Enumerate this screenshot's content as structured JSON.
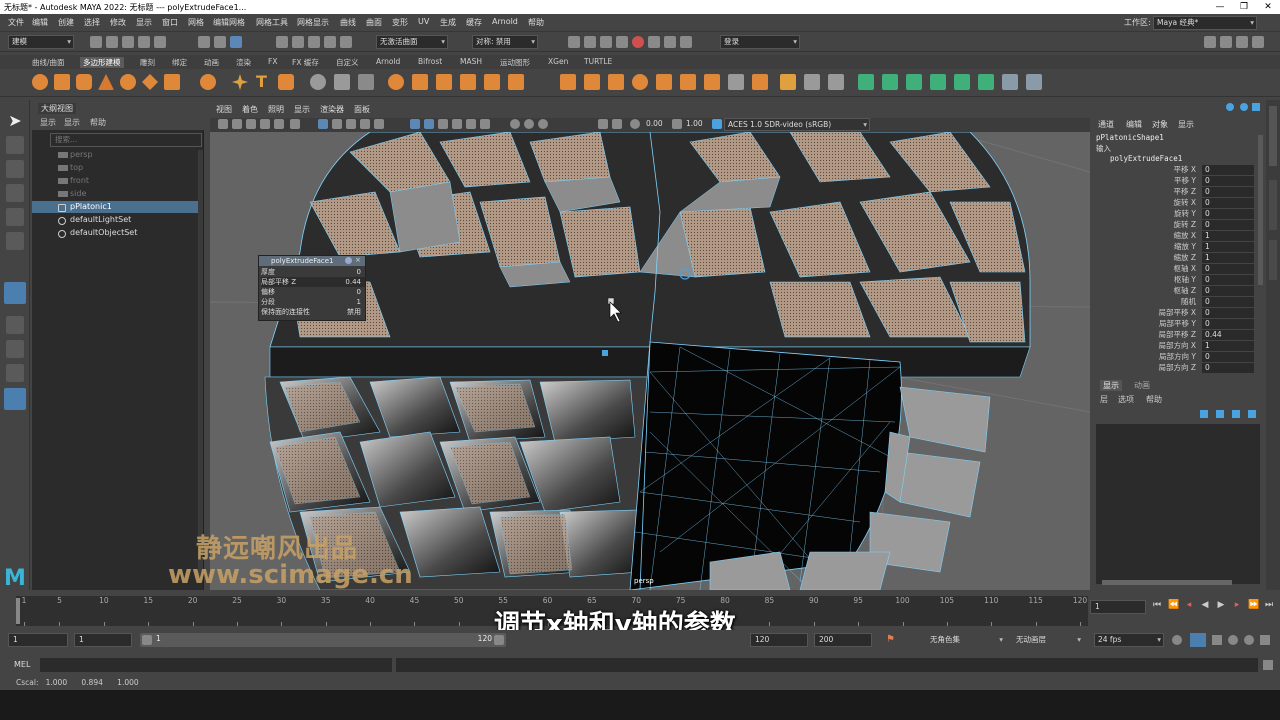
{
  "titlebar": {
    "text": "无标题* - Autodesk MAYA 2022: 无标题   ---   polyExtrudeFace1...",
    "minimize": "—",
    "restore": "❐",
    "close": "✕"
  },
  "menubar": {
    "items": [
      "文件",
      "编辑",
      "创建",
      "选择",
      "修改",
      "显示",
      "窗口",
      "网格",
      "编辑网格",
      "网格工具",
      "网格显示",
      "曲线",
      "曲面",
      "变形",
      "UV",
      "生成",
      "缓存",
      "Arnold",
      "帮助"
    ],
    "workspace_label": "工作区:",
    "workspace_value": "Maya 经典*"
  },
  "statusline": {
    "mode": "建模",
    "live_surface": "无激活曲面",
    "symmetry": "对称: 禁用",
    "login": "登录"
  },
  "shelf": {
    "tabs": [
      "曲线/曲面",
      "多边形建模",
      "雕刻",
      "绑定",
      "动画",
      "渲染",
      "FX",
      "FX 缓存",
      "自定义",
      "Arnold",
      "Bifrost",
      "MASH",
      "运动图形",
      "XGen",
      "TURTLE"
    ],
    "active_tab": "多边形建模"
  },
  "outliner": {
    "title": "大纲视图",
    "menu": [
      "显示",
      "显示",
      "帮助"
    ],
    "search_placeholder": "搜索...",
    "items": [
      "persp",
      "top",
      "front",
      "side",
      "pPlatonic1",
      "defaultLightSet",
      "defaultObjectSet"
    ]
  },
  "viewport": {
    "menu": [
      "视图",
      "着色",
      "照明",
      "显示",
      "渲染器",
      "面板"
    ],
    "exposure": "0.00",
    "gamma": "1.00",
    "colorspace": "ACES 1.0 SDR-video (sRGB)",
    "camera_label": "persp"
  },
  "extrude_hud": {
    "title": "polyExtrudeFace1",
    "rows": [
      {
        "label": "厚度",
        "value": "0"
      },
      {
        "label": "局部平移 Z",
        "value": "0.44"
      },
      {
        "label": "偏移",
        "value": "0"
      },
      {
        "label": "分段",
        "value": "1"
      },
      {
        "label": "保持面的连接性",
        "value": "禁用"
      }
    ]
  },
  "channelbox": {
    "menu": [
      "通道",
      "编辑",
      "对象",
      "显示"
    ],
    "shape_name": "pPlatonicShape1",
    "inputs_label": "输入",
    "node_name": "polyExtrudeFace1",
    "channels": [
      {
        "name": "平移 X",
        "value": "0"
      },
      {
        "name": "平移 Y",
        "value": "0"
      },
      {
        "name": "平移 Z",
        "value": "0"
      },
      {
        "name": "旋转 X",
        "value": "0"
      },
      {
        "name": "旋转 Y",
        "value": "0"
      },
      {
        "name": "旋转 Z",
        "value": "0"
      },
      {
        "name": "缩放 X",
        "value": "1"
      },
      {
        "name": "缩放 Y",
        "value": "1"
      },
      {
        "name": "缩放 Z",
        "value": "1"
      },
      {
        "name": "枢轴 X",
        "value": "0"
      },
      {
        "name": "枢轴 Y",
        "value": "0"
      },
      {
        "name": "枢轴 Z",
        "value": "0"
      },
      {
        "name": "随机",
        "value": "0"
      },
      {
        "name": "局部平移 X",
        "value": "0"
      },
      {
        "name": "局部平移 Y",
        "value": "0"
      },
      {
        "name": "局部平移 Z",
        "value": "0.44"
      },
      {
        "name": "局部方向 X",
        "value": "1"
      },
      {
        "name": "局部方向 Y",
        "value": "0"
      },
      {
        "name": "局部方向 Z",
        "value": "0"
      }
    ]
  },
  "layers": {
    "tabs": [
      "显示",
      "动画"
    ],
    "menu": [
      "层",
      "选项",
      "帮助"
    ]
  },
  "timeline": {
    "ticks": [
      1,
      5,
      10,
      15,
      20,
      25,
      30,
      35,
      40,
      45,
      50,
      55,
      60,
      65,
      70,
      75,
      80,
      85,
      90,
      95,
      100,
      105,
      110,
      115,
      120
    ],
    "current_frame": "1"
  },
  "range": {
    "start": "1",
    "playback_start": "1",
    "slider_start": "1",
    "slider_end": "120",
    "playback_end": "120",
    "end": "200",
    "char_set": "无角色集",
    "anim_layer": "无动画层",
    "fps": "24 fps"
  },
  "cmdline": {
    "label": "MEL"
  },
  "helpline": {
    "text": "Cscal:   1.000      0.894      1.000"
  },
  "overlays": {
    "watermark_cn": "静远嘲风出品",
    "watermark_url": "www.scimage.cn",
    "subtitle": "调节x轴和y轴的参数"
  },
  "colors": {
    "wire": "#7fd4ff",
    "face_tan": "#b39a86",
    "face_dark": "#1c1c1c",
    "face_grey": "#8c8c8c",
    "accent": "#4aa3df",
    "watermark": "#c8a266"
  }
}
